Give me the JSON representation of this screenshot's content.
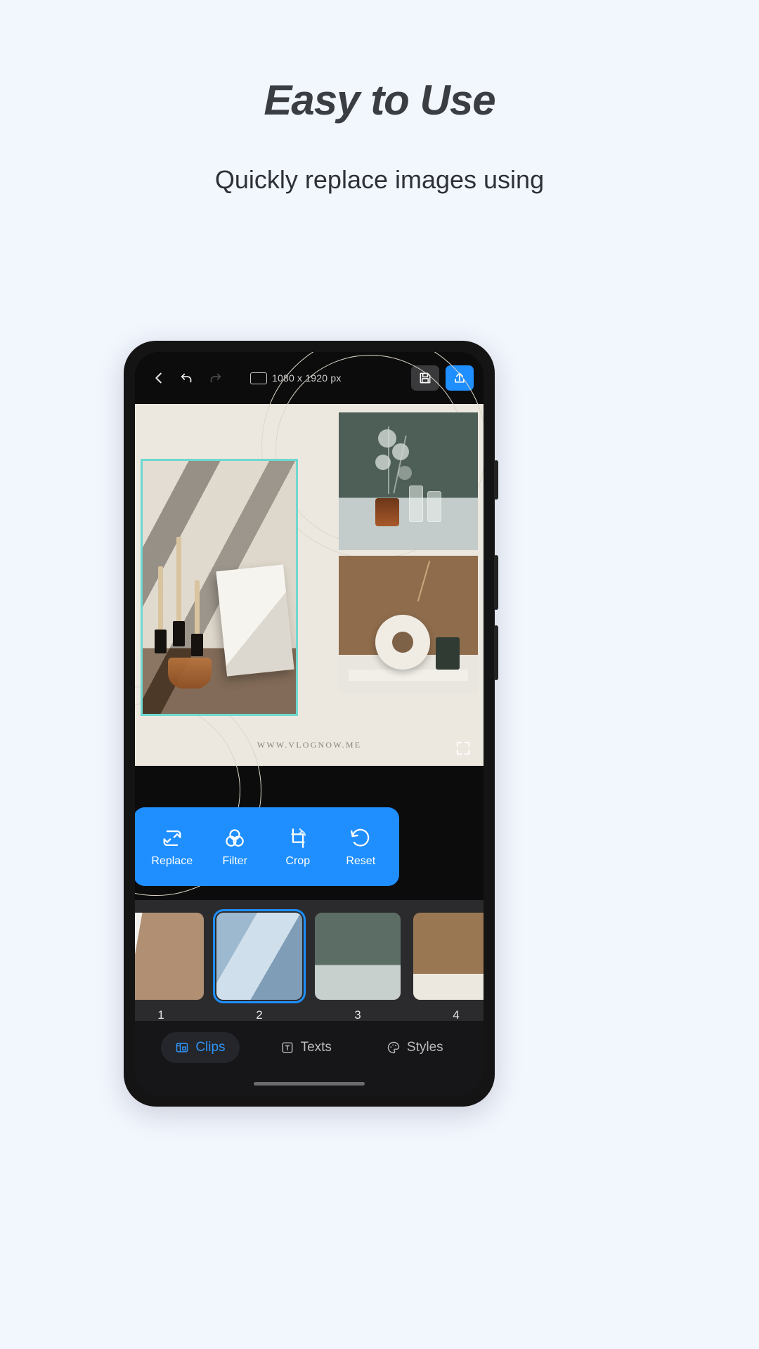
{
  "promo": {
    "title": "Easy to Use",
    "subtitle": "Quickly replace images using"
  },
  "colors": {
    "page_bg": "#f2f6fd",
    "accent_blue": "#1f8fff",
    "tab_active_blue": "#2f93f5",
    "selection_teal": "#6fd8d0",
    "phone_body": "#141414",
    "tray_bg": "#2b2b2d",
    "tabbar_bg": "#161618"
  },
  "editor": {
    "toolbar": {
      "back_icon": "chevron-left-icon",
      "undo_icon": "undo-icon",
      "redo_icon": "redo-icon",
      "redo_disabled": true,
      "canvas_icon": "canvas-size-icon",
      "canvas_size": "1080 x 1920 px",
      "save_icon": "floppy-disk-icon",
      "share_icon": "export-upload-icon"
    },
    "canvas": {
      "watermark": "WWW.VLOGNOW.ME",
      "expand_icon": "fullscreen-expand-icon",
      "selected_cell": "main-photo-candles"
    },
    "actions": [
      {
        "label": "Replace",
        "icon": "replace-icon"
      },
      {
        "label": "Filter",
        "icon": "filter-circles-icon"
      },
      {
        "label": "Crop",
        "icon": "crop-rotate-icon"
      },
      {
        "label": "Reset",
        "icon": "reset-icon"
      }
    ],
    "clips": [
      {
        "number": "1",
        "name": "dried-flowers-vase",
        "selected": false
      },
      {
        "number": "2",
        "name": "candles-envelope",
        "selected": true
      },
      {
        "number": "3",
        "name": "eucalyptus-candle",
        "selected": false
      },
      {
        "number": "4",
        "name": "donut-vase",
        "selected": false
      }
    ],
    "tabs": [
      {
        "label": "Clips",
        "icon": "clips-icon",
        "active": true
      },
      {
        "label": "Texts",
        "icon": "text-box-icon",
        "active": false
      },
      {
        "label": "Styles",
        "icon": "palette-icon",
        "active": false
      }
    ]
  }
}
